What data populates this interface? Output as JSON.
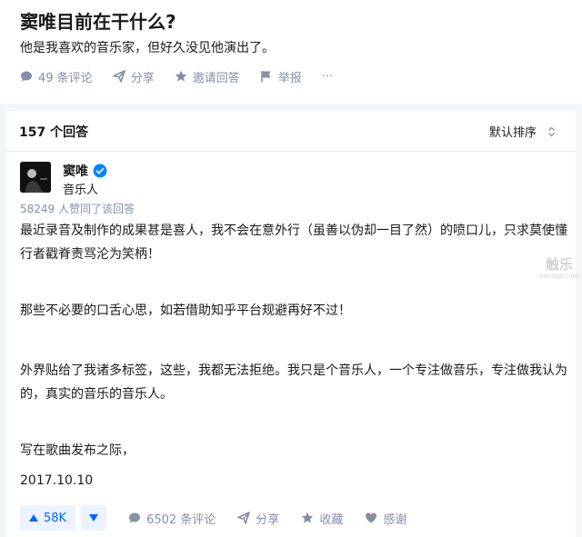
{
  "question": {
    "title": "窦唯目前在干什么?",
    "detail": "他是我喜欢的音乐家，但好久没见他演出了。",
    "actions": {
      "comments": "49 条评论",
      "share": "分享",
      "invite": "邀请回答",
      "report": "举报",
      "more": "···"
    }
  },
  "answers_header": {
    "count": "157 个回答",
    "sort": "默认排序"
  },
  "answer": {
    "author_name": "窦唯",
    "author_bio": "音乐人",
    "votes_meta": "58249 人赞同了该回答",
    "paragraphs": [
      "最近录音及制作的成果甚是喜人，我不会在意外行（虽善以伪却一目了然）的喷口儿，只求莫使懂行者戳脊责骂沦为笑柄！",
      "那些不必要的口舌心思，如若借助知乎平台规避再好不过！",
      "外界贴给了我诸多标签，这些，我都无法拒绝。我只是个音乐人，一个专注做音乐，专注做我认为的，真实的音乐的音乐人。",
      "写在歌曲发布之际，",
      "2017.10.10"
    ],
    "footer": {
      "upvote": "58K",
      "comments": "6502 条评论",
      "share": "分享",
      "favorite": "收藏",
      "thanks": "感谢"
    }
  },
  "watermark": {
    "text": "触乐",
    "subtext": "chuapp.com"
  },
  "colors": {
    "accent": "#0066ff",
    "meta": "#8590a6",
    "verified": "#0084ff"
  }
}
